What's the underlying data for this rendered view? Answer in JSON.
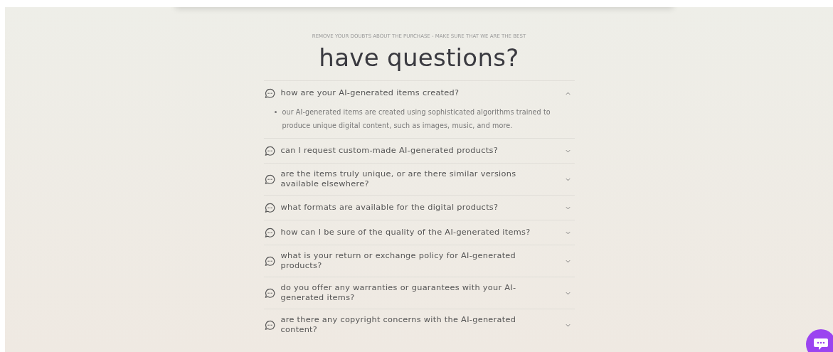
{
  "eyebrow": "REMOVE YOUR DOUBTS ABOUT THE PURCHASE - MAKE SURE THAT WE ARE THE BEST",
  "title": "have questions?",
  "faq": [
    {
      "question": "how are your AI-generated items created?",
      "expanded": true,
      "answer": "our AI-generated items are created using sophisticated algorithms trained to produce unique digital content, such as images, music, and more."
    },
    {
      "question": "can I request custom-made AI-generated products?",
      "expanded": false
    },
    {
      "question": "are the items truly unique, or are there similar versions available elsewhere?",
      "expanded": false
    },
    {
      "question": "what formats are available for the digital products?",
      "expanded": false
    },
    {
      "question": "how can I be sure of the quality of the AI-generated items?",
      "expanded": false
    },
    {
      "question": "what is your return or exchange policy for AI-generated products?",
      "expanded": false
    },
    {
      "question": "do you offer any warranties or guarantees with your AI-generated items?",
      "expanded": false
    },
    {
      "question": "are there any copyright concerns with the AI-generated content?",
      "expanded": false
    }
  ]
}
